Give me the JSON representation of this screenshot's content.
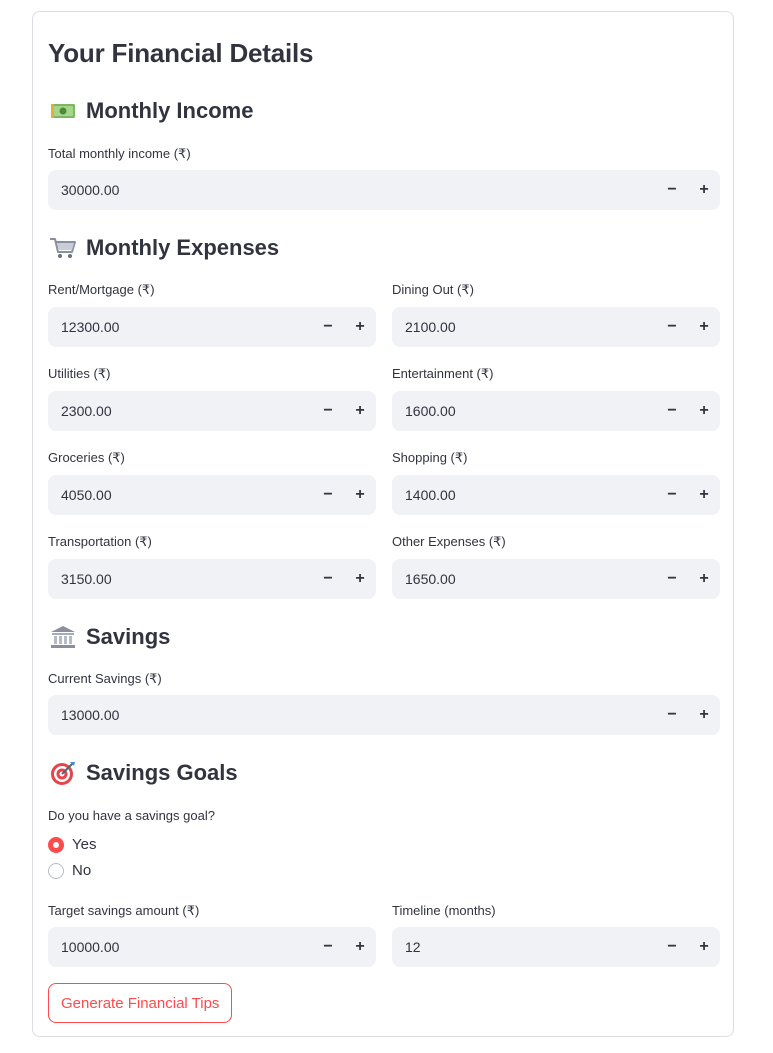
{
  "title": "Your Financial Details",
  "income": {
    "heading": "Monthly Income",
    "icon": "money-icon",
    "total": {
      "label": "Total monthly income (₹)",
      "value": "30000.00"
    }
  },
  "expenses": {
    "heading": "Monthly Expenses",
    "icon": "shopping-cart-icon",
    "rent": {
      "label": "Rent/Mortgage (₹)",
      "value": "12300.00"
    },
    "dining": {
      "label": "Dining Out (₹)",
      "value": "2100.00"
    },
    "utilities": {
      "label": "Utilities (₹)",
      "value": "2300.00"
    },
    "entertainment": {
      "label": "Entertainment (₹)",
      "value": "1600.00"
    },
    "groceries": {
      "label": "Groceries (₹)",
      "value": "4050.00"
    },
    "shopping": {
      "label": "Shopping (₹)",
      "value": "1400.00"
    },
    "transportation": {
      "label": "Transportation (₹)",
      "value": "3150.00"
    },
    "other": {
      "label": "Other Expenses (₹)",
      "value": "1650.00"
    }
  },
  "savings": {
    "heading": "Savings",
    "icon": "bank-icon",
    "current": {
      "label": "Current Savings (₹)",
      "value": "13000.00"
    }
  },
  "goals": {
    "heading": "Savings Goals",
    "icon": "target-icon",
    "question": "Do you have a savings goal?",
    "options": [
      {
        "label": "Yes",
        "selected": true
      },
      {
        "label": "No",
        "selected": false
      }
    ],
    "target": {
      "label": "Target savings amount (₹)",
      "value": "10000.00"
    },
    "timeline": {
      "label": "Timeline (months)",
      "value": "12"
    }
  },
  "stepper": {
    "minus": "−",
    "plus": "+"
  },
  "generate_button": "Generate Financial Tips",
  "colors": {
    "accent": "#ff4b4b",
    "field_bg": "#f0f2f6",
    "text": "#31333f",
    "border": "#dcdce2"
  }
}
